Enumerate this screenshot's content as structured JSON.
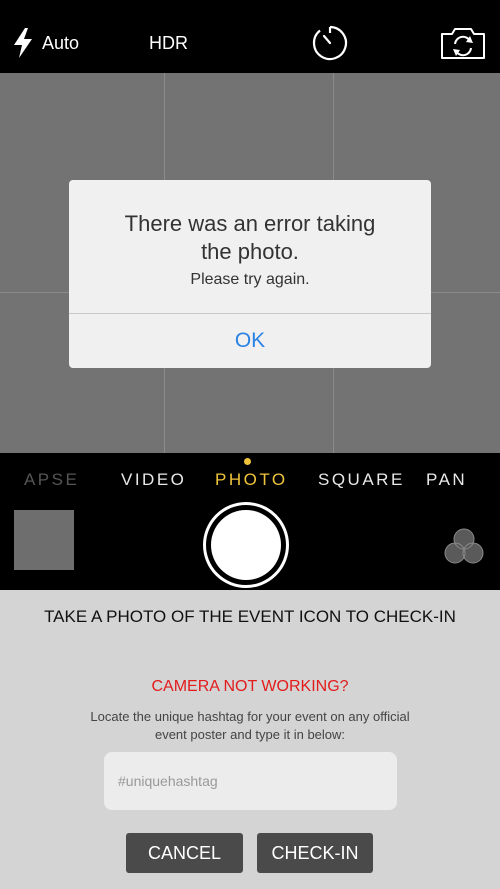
{
  "top_bar": {
    "flash_label": "Auto",
    "hdr_label": "HDR",
    "icons": [
      "flash-icon",
      "timer-icon",
      "camera-flip-icon"
    ]
  },
  "alert": {
    "title_line1": "There was an error taking",
    "title_line2": "the photo.",
    "message": "Please try again.",
    "ok_label": "OK",
    "ok_color": "#2a83e3"
  },
  "modes": {
    "items": [
      "LAPSE",
      "VIDEO",
      "PHOTO",
      "SQUARE",
      "PAN"
    ],
    "active": "PHOTO",
    "active_color": "#f0c43a"
  },
  "controls": {
    "icons": [
      "last-photo-thumbnail",
      "shutter-button",
      "filters-icon"
    ]
  },
  "checkin_panel": {
    "heading": "TAKE A PHOTO OF THE EVENT ICON TO CHECK-IN",
    "alert_text": "CAMERA NOT WORKING?",
    "alert_color": "#e31b1b",
    "instructions": "Locate the unique hashtag for your event on any official event poster and type it in below:",
    "input_value": "",
    "input_placeholder": "#uniquehashtag",
    "cancel_label": "CANCEL",
    "checkin_label": "CHECK-IN"
  }
}
